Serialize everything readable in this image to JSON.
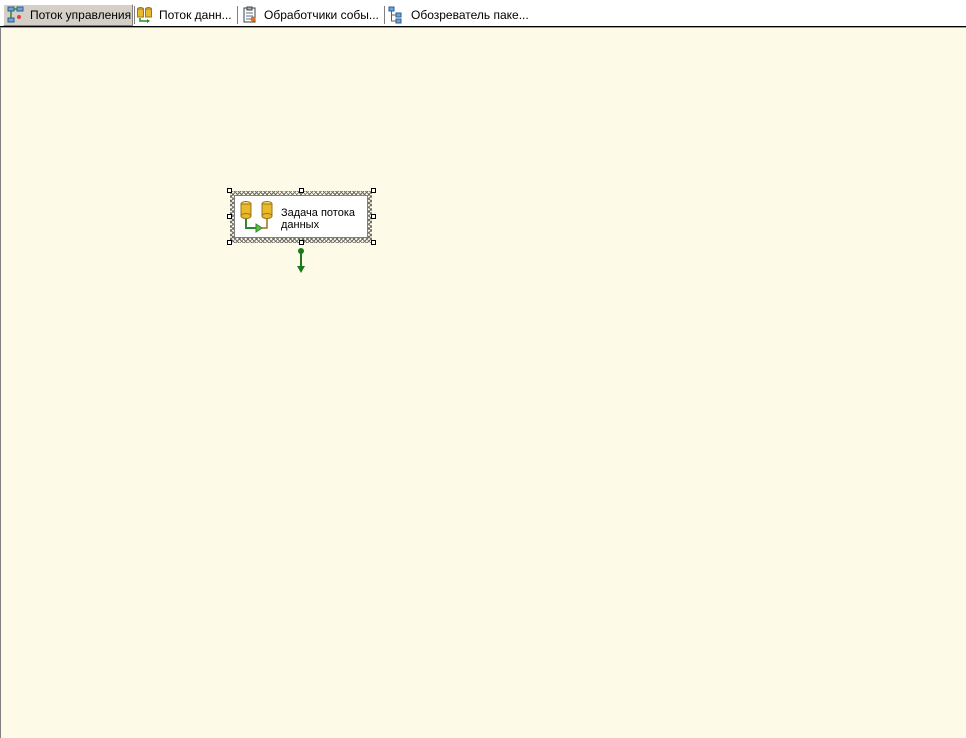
{
  "tabs": [
    {
      "label": "Поток управления",
      "icon": "control-flow-icon",
      "active": true
    },
    {
      "label": "Поток данн...",
      "icon": "data-flow-icon",
      "active": false
    },
    {
      "label": "Обработчики собы...",
      "icon": "event-handlers-icon",
      "active": false
    },
    {
      "label": "Обозреватель паке...",
      "icon": "package-explorer-icon",
      "active": false
    }
  ],
  "canvas": {
    "background": "#fdfae8",
    "task": {
      "label_line1": "Задача потока",
      "label_line2": "данных",
      "icon": "data-flow-task-icon",
      "selected": true
    },
    "connector": {
      "color": "#1a7a1a",
      "icon": "precedence-arrow-icon"
    }
  }
}
